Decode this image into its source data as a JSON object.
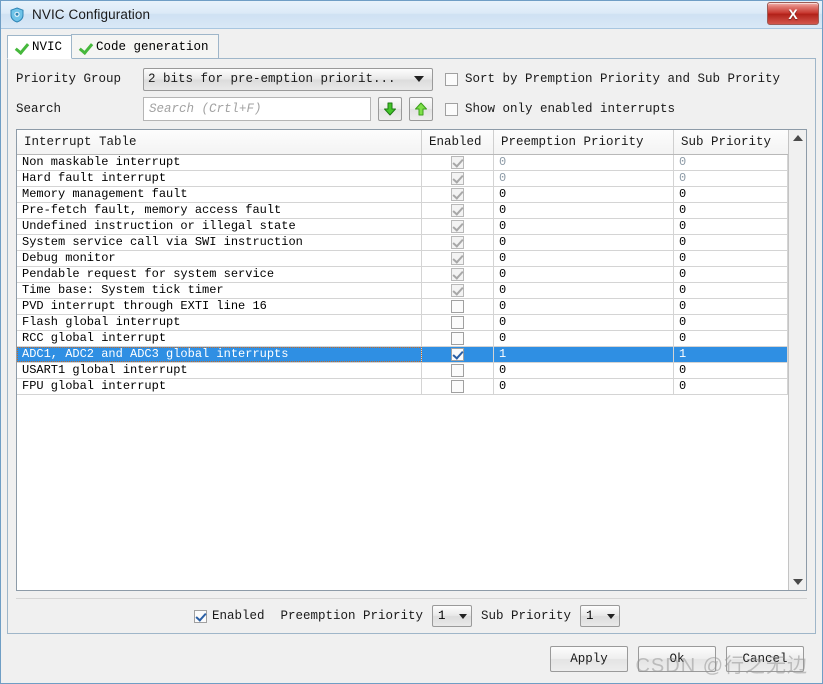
{
  "window": {
    "title": "NVIC Configuration",
    "icon": "nvic-shield-icon",
    "close_label": "X"
  },
  "tabs": [
    {
      "label": "NVIC",
      "active": true
    },
    {
      "label": "Code generation",
      "active": false
    }
  ],
  "options": {
    "priority_group_label": "Priority Group",
    "priority_group_value": "2 bits for pre-emption priorit...",
    "sort_checkbox_label": "Sort by Premption Priority and Sub Prority",
    "sort_checkbox_checked": false,
    "search_label": "Search",
    "search_value": "",
    "search_placeholder": "Search (Crtl+F)",
    "find_next_icon": "arrow-down-icon",
    "find_prev_icon": "arrow-up-icon",
    "show_enabled_label": "Show only enabled interrupts",
    "show_enabled_checked": false
  },
  "table": {
    "headers": [
      "Interrupt Table",
      "Enabled",
      "Preemption Priority",
      "Sub Priority"
    ],
    "rows": [
      {
        "name": "Non maskable interrupt",
        "enabled": true,
        "locked": true,
        "preemption": "0",
        "sub": "0",
        "dim": true,
        "selected": false
      },
      {
        "name": "Hard fault interrupt",
        "enabled": true,
        "locked": true,
        "preemption": "0",
        "sub": "0",
        "dim": true,
        "selected": false
      },
      {
        "name": "Memory management fault",
        "enabled": true,
        "locked": true,
        "preemption": "0",
        "sub": "0",
        "dim": false,
        "selected": false
      },
      {
        "name": "Pre-fetch fault, memory access fault",
        "enabled": true,
        "locked": true,
        "preemption": "0",
        "sub": "0",
        "dim": false,
        "selected": false
      },
      {
        "name": "Undefined instruction or illegal state",
        "enabled": true,
        "locked": true,
        "preemption": "0",
        "sub": "0",
        "dim": false,
        "selected": false
      },
      {
        "name": "System service call via SWI instruction",
        "enabled": true,
        "locked": true,
        "preemption": "0",
        "sub": "0",
        "dim": false,
        "selected": false
      },
      {
        "name": "Debug monitor",
        "enabled": true,
        "locked": true,
        "preemption": "0",
        "sub": "0",
        "dim": false,
        "selected": false
      },
      {
        "name": "Pendable request for system service",
        "enabled": true,
        "locked": true,
        "preemption": "0",
        "sub": "0",
        "dim": false,
        "selected": false
      },
      {
        "name": "Time base: System tick timer",
        "enabled": true,
        "locked": true,
        "preemption": "0",
        "sub": "0",
        "dim": false,
        "selected": false
      },
      {
        "name": "PVD interrupt through EXTI line 16",
        "enabled": false,
        "locked": false,
        "preemption": "0",
        "sub": "0",
        "dim": false,
        "selected": false
      },
      {
        "name": "Flash global interrupt",
        "enabled": false,
        "locked": false,
        "preemption": "0",
        "sub": "0",
        "dim": false,
        "selected": false
      },
      {
        "name": "RCC global interrupt",
        "enabled": false,
        "locked": false,
        "preemption": "0",
        "sub": "0",
        "dim": false,
        "selected": false
      },
      {
        "name": "ADC1, ADC2 and ADC3 global interrupts",
        "enabled": true,
        "locked": false,
        "preemption": "1",
        "sub": "1",
        "dim": false,
        "selected": true
      },
      {
        "name": "USART1 global interrupt",
        "enabled": false,
        "locked": false,
        "preemption": "0",
        "sub": "0",
        "dim": false,
        "selected": false
      },
      {
        "name": "FPU global interrupt",
        "enabled": false,
        "locked": false,
        "preemption": "0",
        "sub": "0",
        "dim": false,
        "selected": false
      }
    ]
  },
  "detail": {
    "enabled_label": "Enabled",
    "enabled_checked": true,
    "preemption_label": "Preemption Priority",
    "preemption_value": "1",
    "sub_label": "Sub Priority",
    "sub_value": "1"
  },
  "footer": {
    "apply_label": "Apply",
    "ok_label": "Ok",
    "cancel_label": "Cancel"
  },
  "watermark": "CSDN @行之无边",
  "colors": {
    "selection_blue": "#2f8fe3",
    "tick_green": "#46b83c",
    "close_red": "#c5322a",
    "frame_blue": "#6f9ec5"
  }
}
